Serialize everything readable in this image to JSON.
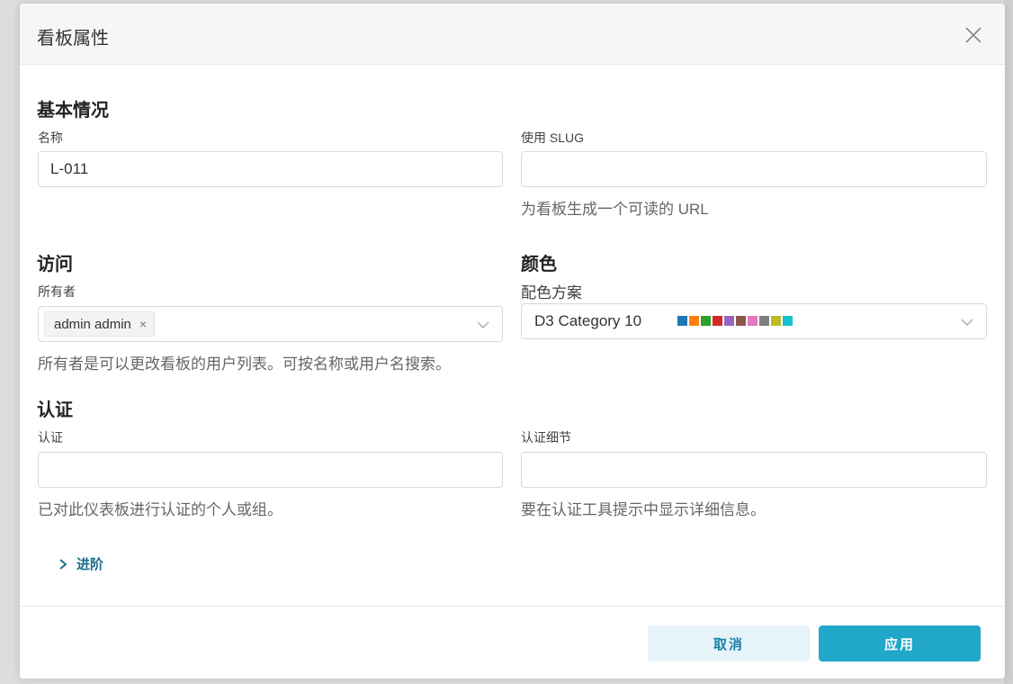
{
  "modal": {
    "title": "看板属性"
  },
  "basic": {
    "section_title": "基本情况",
    "name_label": "名称",
    "name_value": "L-011",
    "slug_label": "使用 SLUG",
    "slug_value": "",
    "slug_help": "为看板生成一个可读的 URL"
  },
  "access": {
    "section_title": "访问",
    "owners_label": "所有者",
    "owner_tag": "admin admin",
    "owner_tag_remove": "×",
    "owners_help": "所有者是可以更改看板的用户列表。可按名称或用户名搜索。"
  },
  "color": {
    "section_title": "颜色",
    "scheme_label": "配色方案",
    "scheme_value": "D3 Category 10",
    "swatches": [
      "#1f77b4",
      "#ff7f0e",
      "#2ca02c",
      "#d62728",
      "#9467bd",
      "#8c564b",
      "#e377c2",
      "#7f7f7f",
      "#bcbd22",
      "#17becf"
    ]
  },
  "certification": {
    "section_title": "认证",
    "cert_label": "认证",
    "cert_value": "",
    "cert_help": "已对此仪表板进行认证的个人或组。",
    "details_label": "认证细节",
    "details_value": "",
    "details_help": "要在认证工具提示中显示详细信息。"
  },
  "advanced": {
    "label": "进阶"
  },
  "footer": {
    "cancel_label": "取消",
    "apply_label": "应用"
  }
}
